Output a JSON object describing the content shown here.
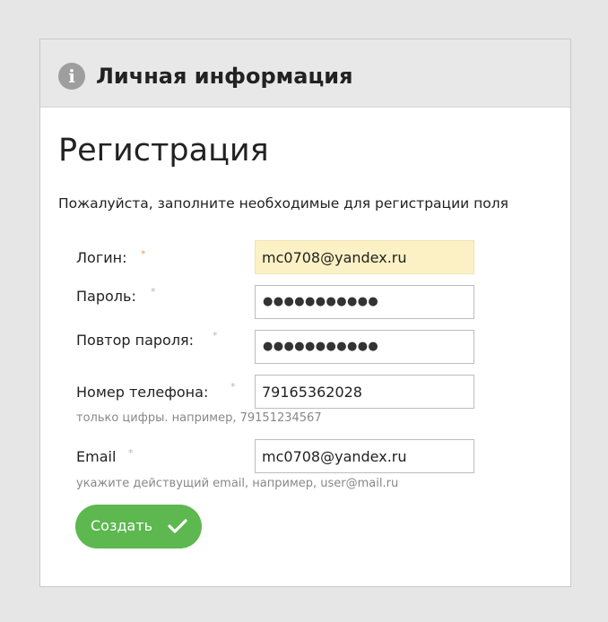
{
  "panel": {
    "title": "Личная информация",
    "info_icon_glyph": "i",
    "info_icon": "info-icon"
  },
  "form": {
    "heading": "Регистрация",
    "intro": "Пожалуйста, заполните необходимые для регистрации поля",
    "required_mark": "*",
    "fields": [
      {
        "label": "Логин:",
        "value": "mc0708@yandex.ru",
        "autofilled": true
      },
      {
        "label": "Пароль:",
        "masked_value": "●●●●●●●●●●●",
        "type": "password"
      },
      {
        "label": "Повтор пароля:",
        "masked_value": "●●●●●●●●●●●",
        "type": "password"
      },
      {
        "label": "Номер телефона:",
        "value": "79165362028",
        "hint": "только цифры. например, 79151234567"
      },
      {
        "label": "Email",
        "value": "mc0708@yandex.ru",
        "hint": "укажите действущий email, например, user@mail.ru"
      }
    ],
    "submit": {
      "label": "Создать",
      "icon": "check-icon"
    }
  },
  "colors": {
    "page_background": "#e6e6e6",
    "header_background": "#e8e8e8",
    "autofill_background": "#fbf1c4",
    "button_green": "#5cb84f",
    "hint_gray": "#888888"
  }
}
